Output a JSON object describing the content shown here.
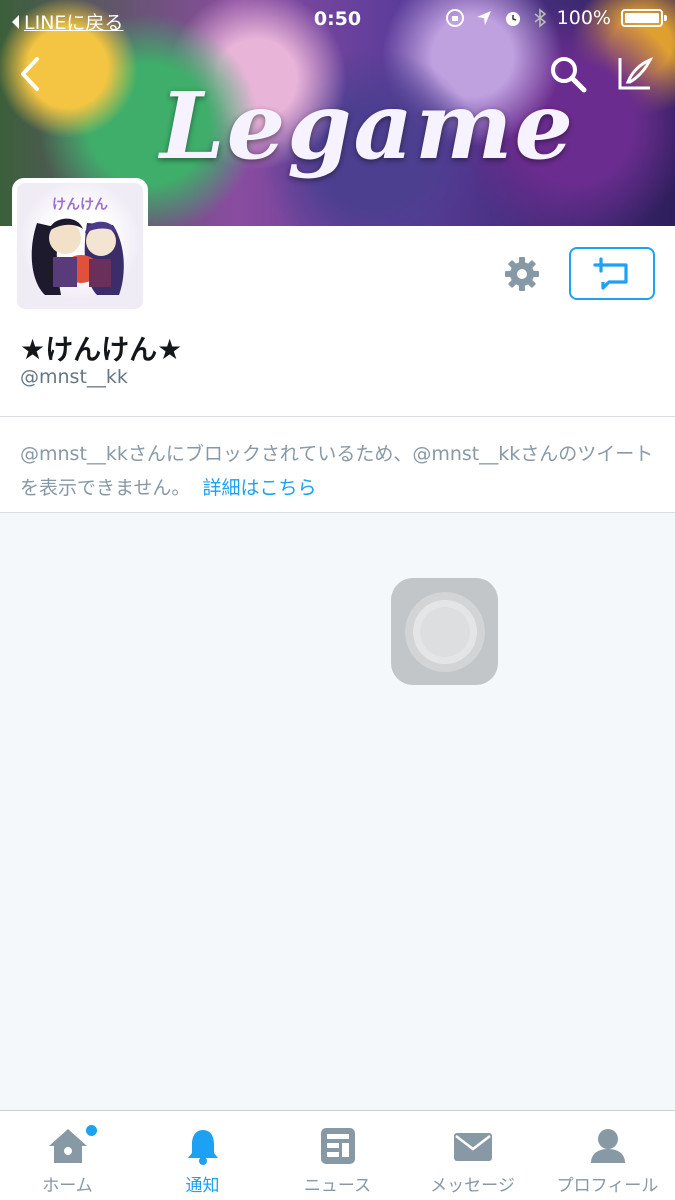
{
  "status_bar": {
    "back_app_label": "LINEに戻る",
    "time": "0:50",
    "battery_percent": "100%"
  },
  "banner": {
    "logo_text": "Legame"
  },
  "profile": {
    "name": "★けんけん★",
    "handle": "@mnst__kk",
    "avatar_label": "けんけん"
  },
  "blocked_notice": {
    "message": "@mnst__kkさんにブロックされているため、@mnst__kkさんのツイートを表示できません。",
    "link_label": "詳細はこちら"
  },
  "tabs": [
    {
      "label": "ホーム",
      "icon": "home-icon",
      "active": false,
      "has_dot": true
    },
    {
      "label": "通知",
      "icon": "bell-icon",
      "active": true,
      "has_dot": false
    },
    {
      "label": "ニュース",
      "icon": "news-icon",
      "active": false,
      "has_dot": false
    },
    {
      "label": "メッセージ",
      "icon": "envelope-icon",
      "active": false,
      "has_dot": false
    },
    {
      "label": "プロフィール",
      "icon": "person-icon",
      "active": false,
      "has_dot": false
    }
  ],
  "colors": {
    "accent": "#1da1f2",
    "muted": "#8899a6",
    "text": "#14171a",
    "background": "#f5f8fa"
  }
}
